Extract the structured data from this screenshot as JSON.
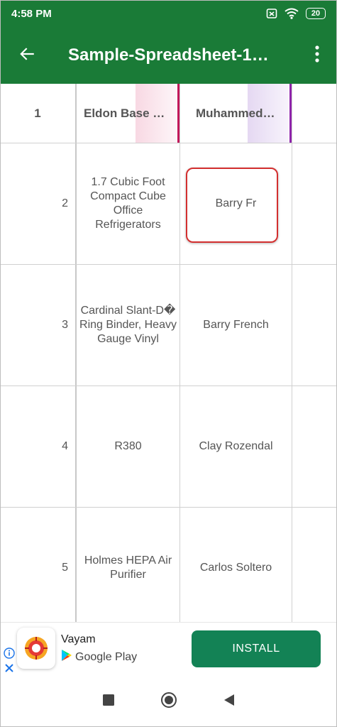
{
  "status_bar": {
    "time": "4:58 PM",
    "battery": "20",
    "icons": [
      "sim-off-icon",
      "wifi-icon",
      "battery-icon"
    ]
  },
  "app_bar": {
    "title": "Sample-Spreadsheet-1…",
    "icons": [
      "back-arrow-icon",
      "more-vert-icon"
    ]
  },
  "grid": {
    "header": {
      "row_number": "1",
      "columns": [
        "Eldon Base …",
        "Muhammed…",
        ""
      ]
    },
    "rows": [
      {
        "number": "2",
        "col1": "1.7 Cubic Foot Compact Cube Office Refrigerators",
        "col2": "Barry Fr",
        "col3": ""
      },
      {
        "number": "3",
        "col1": "Cardinal Slant-D� Ring Binder, Heavy Gauge Vinyl",
        "col2": "Barry French",
        "col3": ""
      },
      {
        "number": "4",
        "col1": "R380",
        "col2": "Clay Rozendal",
        "col3": ""
      },
      {
        "number": "5",
        "col1": "Holmes HEPA Air Purifier",
        "col2": "Carlos Soltero",
        "col3": ""
      }
    ]
  },
  "ad": {
    "app_name": "Vayam",
    "store": "Google Play",
    "install_label": "INSTALL",
    "colors": {
      "install_bg": "#138255",
      "close": "#1a73e8"
    }
  },
  "nav_bar": {
    "icons": [
      "recents-square-icon",
      "home-circle-icon",
      "back-triangle-icon"
    ]
  },
  "colors": {
    "toolbar": "#1a7b37",
    "header_accent_1": "#c2185b",
    "header_accent_2": "#8e24aa",
    "highlight": "#d32f2f"
  }
}
